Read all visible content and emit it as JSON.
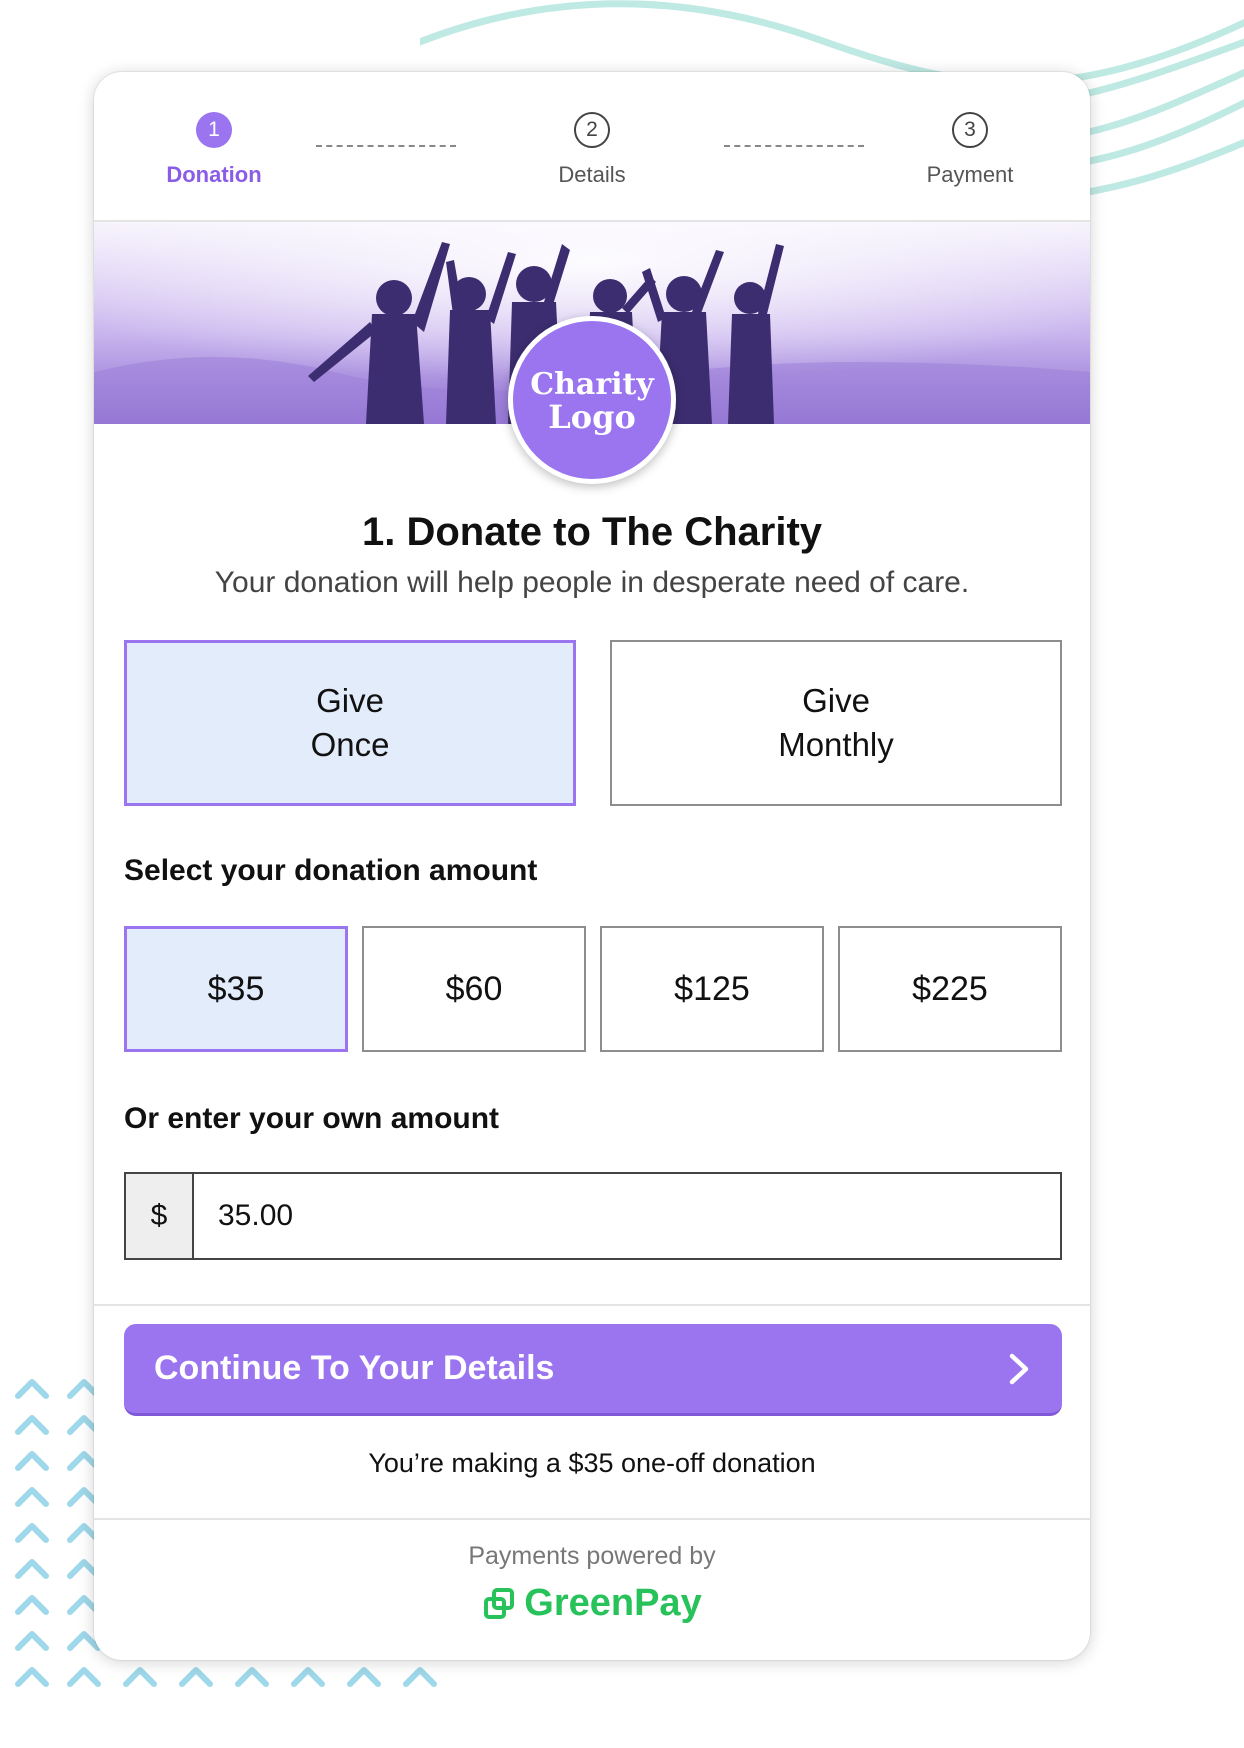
{
  "steps": [
    {
      "number": "1",
      "label": "Donation",
      "state": "active"
    },
    {
      "number": "2",
      "label": "Details",
      "state": "idle"
    },
    {
      "number": "3",
      "label": "Payment",
      "state": "idle"
    }
  ],
  "hero": {
    "logo_line1": "Charity",
    "logo_line2": "Logo"
  },
  "heading": {
    "title": "1. Donate to The Charity",
    "subtitle": "Your donation will help people in desperate need of care."
  },
  "frequency": {
    "once": {
      "line1": "Give",
      "line2": "Once",
      "selected": true
    },
    "monthly": {
      "line1": "Give",
      "line2": "Monthly",
      "selected": false
    }
  },
  "amounts": {
    "label": "Select your donation amount",
    "options": [
      "$35",
      "$60",
      "$125",
      "$225"
    ],
    "selected": "$35"
  },
  "own_amount": {
    "label": "Or enter your own amount",
    "prefix": "$",
    "value": "35.00"
  },
  "continue_button": {
    "label": "Continue To Your Details",
    "icon": "chevron-right-icon"
  },
  "summary": "You’re making a $35 one-off donation",
  "footer": {
    "powered_by": "Payments powered by",
    "brand": "GreenPay",
    "brand_icon": "greenpay-logo-icon"
  },
  "colors": {
    "accent": "#9b74f0",
    "selected_bg": "#e2ecfb",
    "brand_green": "#27c25a",
    "deco_teal": "#a9e0dc",
    "deco_blue": "#93d3e8"
  }
}
